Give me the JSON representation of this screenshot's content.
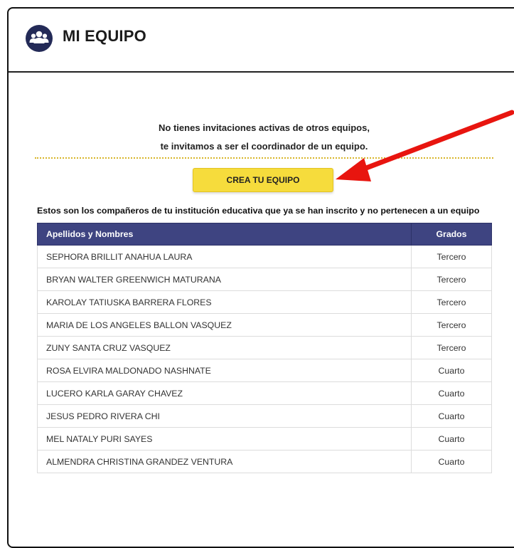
{
  "header": {
    "title": "MI EQUIPO",
    "icon": "team-icon"
  },
  "invitation": {
    "line1": "No tienes invitaciones activas de otros equipos,",
    "line2": "te invitamos a ser el coordinador de un equipo."
  },
  "cta": {
    "label": "CREA TU EQUIPO",
    "color": "#f6dc3c"
  },
  "table": {
    "caption": "Estos son los compañeros de tu institución educativa que ya se han inscrito y no pertenecen a un equipo",
    "columns": [
      "Apellidos y Nombres",
      "Grados"
    ],
    "rows": [
      [
        "SEPHORA BRILLIT ANAHUA LAURA",
        "Tercero"
      ],
      [
        "BRYAN WALTER GREENWICH MATURANA",
        "Tercero"
      ],
      [
        "KAROLAY TATIUSKA BARRERA FLORES",
        "Tercero"
      ],
      [
        "MARIA DE LOS ANGELES BALLON VASQUEZ",
        "Tercero"
      ],
      [
        "ZUNY SANTA CRUZ VASQUEZ",
        "Tercero"
      ],
      [
        "ROSA ELVIRA MALDONADO NASHNATE",
        "Cuarto"
      ],
      [
        "LUCERO KARLA GARAY CHAVEZ",
        "Cuarto"
      ],
      [
        "JESUS PEDRO RIVERA CHI",
        "Cuarto"
      ],
      [
        "MEL NATALY PURI SAYES",
        "Cuarto"
      ],
      [
        "ALMENDRA CHRISTINA GRANDEZ VENTURA",
        "Cuarto"
      ]
    ],
    "header_color": "#3e4481"
  },
  "annotation": {
    "icon": "red-arrow-icon",
    "color": "#e8150f"
  }
}
